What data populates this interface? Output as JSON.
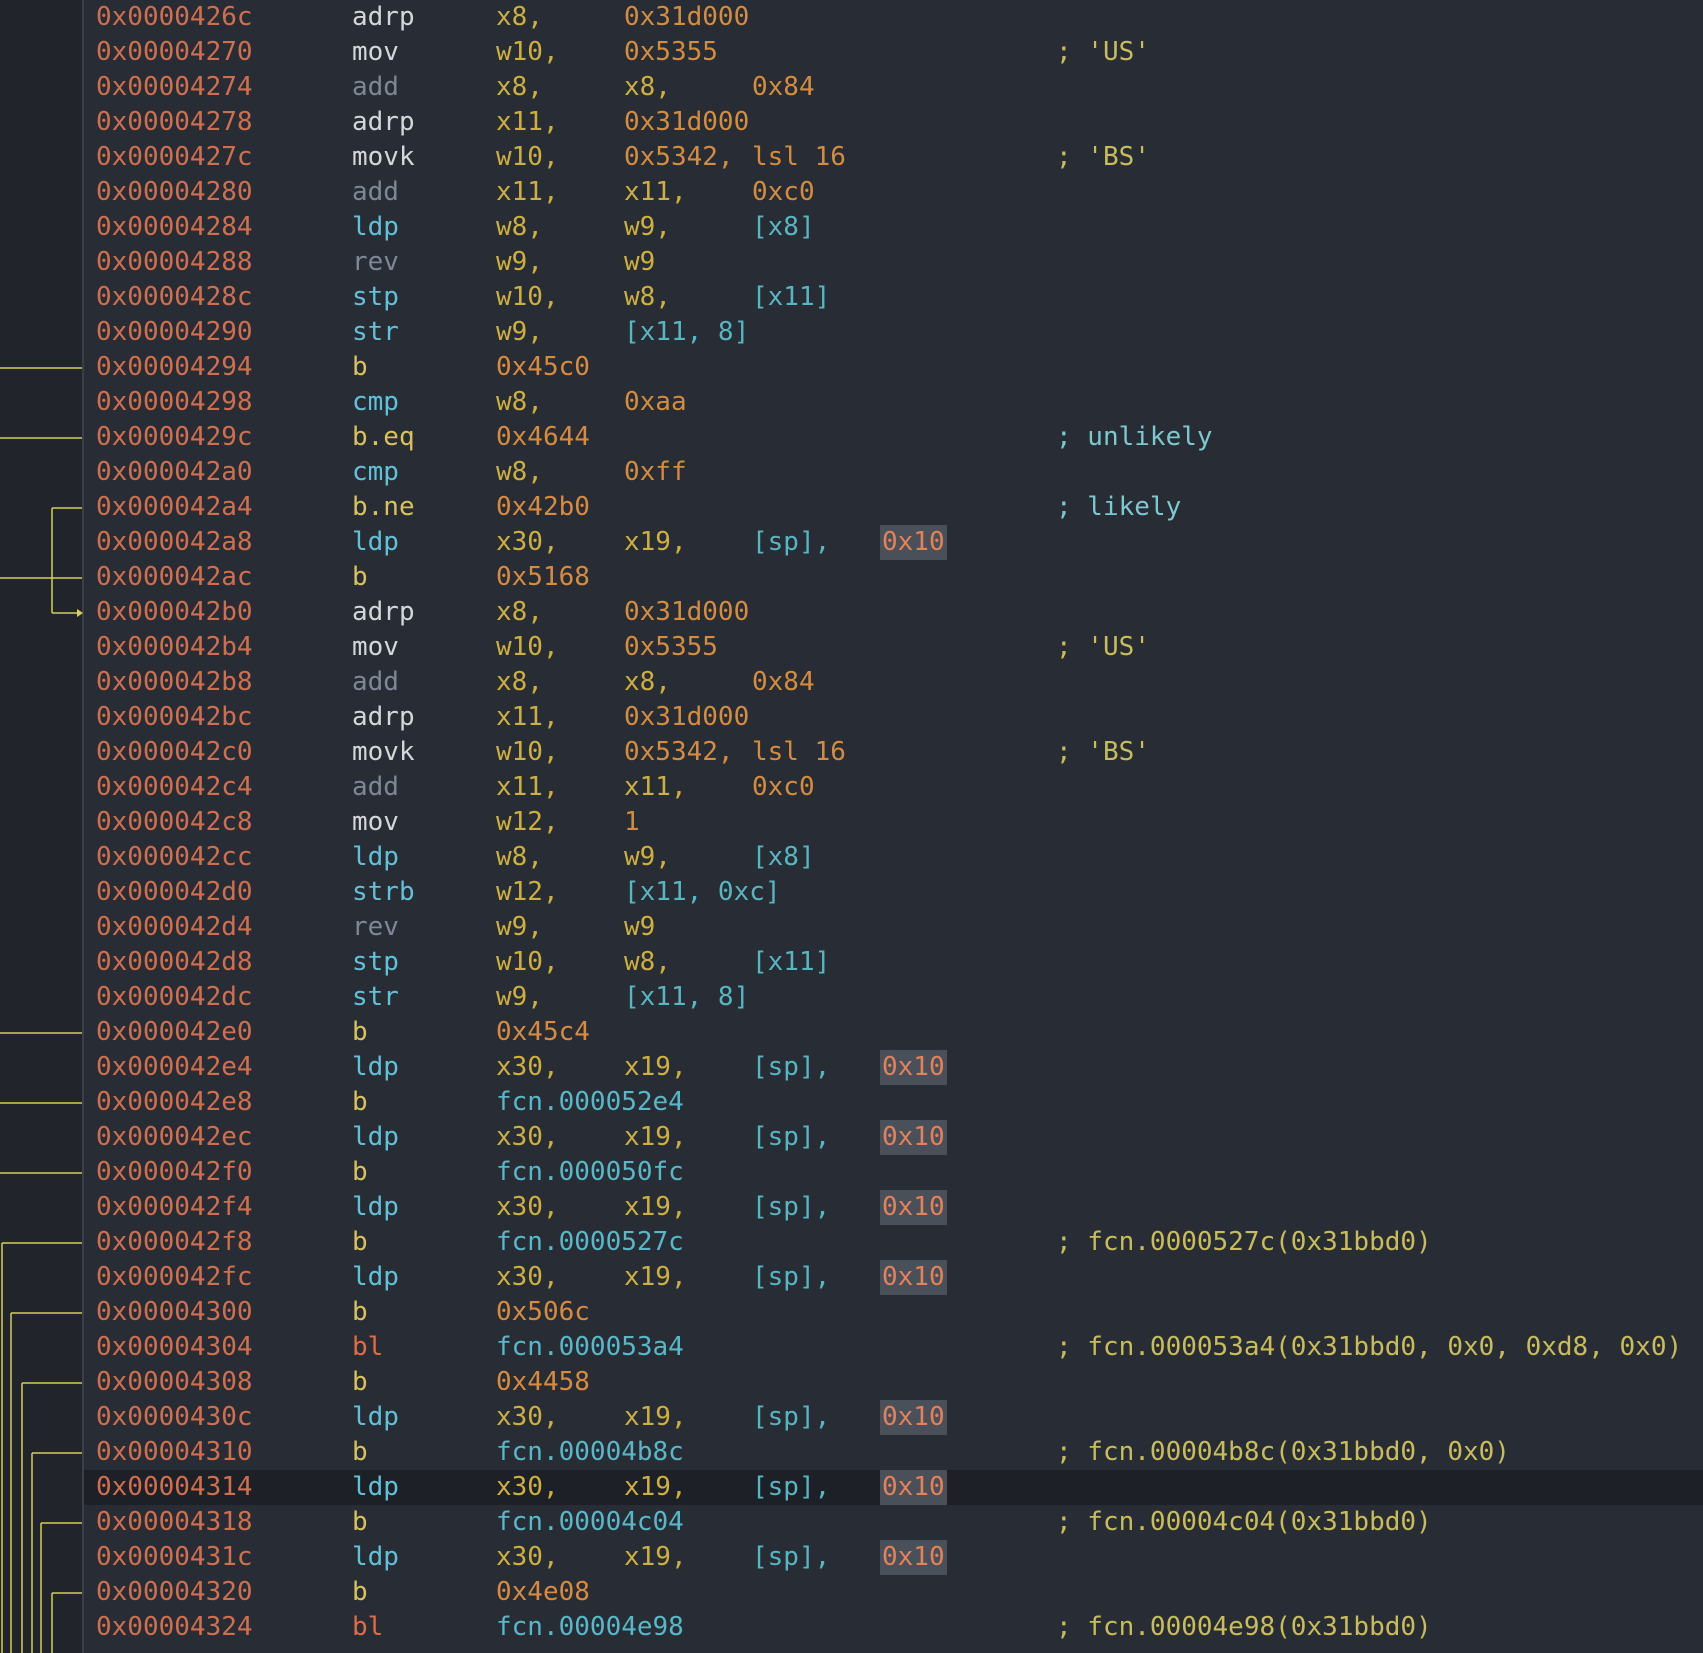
{
  "colors": {
    "background": "#282c34",
    "gutter": "#21252b",
    "address": "#d06f4f",
    "register": "#cdb03f",
    "immediate": "#d48c3e",
    "memory": "#56b6c2",
    "branch_mnemonic": "#d9c25e",
    "call_mnemonic": "#e06c45",
    "arrow": "#d6cf58",
    "highlight_bg": "#4a505a"
  },
  "rows": [
    {
      "addr": "0x0000426c",
      "mn": "adrp",
      "o": [
        [
          "x8,",
          "reg"
        ],
        [
          "0x31d000",
          "num"
        ]
      ]
    },
    {
      "addr": "0x00004270",
      "mn": "mov",
      "o": [
        [
          "w10,",
          "reg"
        ],
        [
          "0x5355",
          "num"
        ]
      ],
      "cm": "; 'US'",
      "cmk": "cmf"
    },
    {
      "addr": "0x00004274",
      "mn": "add",
      "o": [
        [
          "x8,",
          "reg"
        ],
        [
          "x8,",
          "reg"
        ],
        [
          "0x84",
          "num"
        ]
      ]
    },
    {
      "addr": "0x00004278",
      "mn": "adrp",
      "o": [
        [
          "x11,",
          "reg"
        ],
        [
          "0x31d000",
          "num"
        ]
      ]
    },
    {
      "addr": "0x0000427c",
      "mn": "movk",
      "o": [
        [
          "w10,",
          "reg"
        ],
        [
          "0x5342,",
          "num"
        ],
        [
          "lsl 16",
          "num"
        ]
      ],
      "cm": "; 'BS'",
      "cmk": "cmf"
    },
    {
      "addr": "0x00004280",
      "mn": "add",
      "o": [
        [
          "x11,",
          "reg"
        ],
        [
          "x11,",
          "reg"
        ],
        [
          "0xc0",
          "num"
        ]
      ]
    },
    {
      "addr": "0x00004284",
      "mn": "ldp",
      "o": [
        [
          "w8,",
          "reg"
        ],
        [
          "w9,",
          "reg"
        ],
        [
          "[x8]",
          "mem"
        ]
      ]
    },
    {
      "addr": "0x00004288",
      "mn": "rev",
      "o": [
        [
          "w9,",
          "reg"
        ],
        [
          "w9",
          "reg"
        ]
      ]
    },
    {
      "addr": "0x0000428c",
      "mn": "stp",
      "o": [
        [
          "w10,",
          "reg"
        ],
        [
          "w8,",
          "reg"
        ],
        [
          "[x11]",
          "mem"
        ]
      ]
    },
    {
      "addr": "0x00004290",
      "mn": "str",
      "o": [
        [
          "w9,",
          "reg"
        ],
        [
          "[x11, 8]",
          "mem"
        ]
      ]
    },
    {
      "addr": "0x00004294",
      "mn": "b",
      "o": [
        [
          "0x45c0",
          "dst"
        ]
      ]
    },
    {
      "addr": "0x00004298",
      "mn": "cmp",
      "o": [
        [
          "w8,",
          "reg"
        ],
        [
          "0xaa",
          "num"
        ]
      ]
    },
    {
      "addr": "0x0000429c",
      "mn": "b.eq",
      "o": [
        [
          "0x4644",
          "dst"
        ]
      ],
      "cm": "; unlikely",
      "cmk": "cmt"
    },
    {
      "addr": "0x000042a0",
      "mn": "cmp",
      "o": [
        [
          "w8,",
          "reg"
        ],
        [
          "0xff",
          "num"
        ]
      ]
    },
    {
      "addr": "0x000042a4",
      "mn": "b.ne",
      "o": [
        [
          "0x42b0",
          "dst"
        ]
      ],
      "cm": "; likely",
      "cmk": "cmt"
    },
    {
      "addr": "0x000042a8",
      "mn": "ldp",
      "o": [
        [
          "x30,",
          "reg"
        ],
        [
          "x19,",
          "reg"
        ],
        [
          "[sp],",
          "mem"
        ],
        [
          "0x10",
          "hl"
        ]
      ]
    },
    {
      "addr": "0x000042ac",
      "mn": "b",
      "o": [
        [
          "0x5168",
          "dst"
        ]
      ]
    },
    {
      "addr": "0x000042b0",
      "mn": "adrp",
      "o": [
        [
          "x8,",
          "reg"
        ],
        [
          "0x31d000",
          "num"
        ]
      ]
    },
    {
      "addr": "0x000042b4",
      "mn": "mov",
      "o": [
        [
          "w10,",
          "reg"
        ],
        [
          "0x5355",
          "num"
        ]
      ],
      "cm": "; 'US'",
      "cmk": "cmf"
    },
    {
      "addr": "0x000042b8",
      "mn": "add",
      "o": [
        [
          "x8,",
          "reg"
        ],
        [
          "x8,",
          "reg"
        ],
        [
          "0x84",
          "num"
        ]
      ]
    },
    {
      "addr": "0x000042bc",
      "mn": "adrp",
      "o": [
        [
          "x11,",
          "reg"
        ],
        [
          "0x31d000",
          "num"
        ]
      ]
    },
    {
      "addr": "0x000042c0",
      "mn": "movk",
      "o": [
        [
          "w10,",
          "reg"
        ],
        [
          "0x5342,",
          "num"
        ],
        [
          "lsl 16",
          "num"
        ]
      ],
      "cm": "; 'BS'",
      "cmk": "cmf"
    },
    {
      "addr": "0x000042c4",
      "mn": "add",
      "o": [
        [
          "x11,",
          "reg"
        ],
        [
          "x11,",
          "reg"
        ],
        [
          "0xc0",
          "num"
        ]
      ]
    },
    {
      "addr": "0x000042c8",
      "mn": "mov",
      "o": [
        [
          "w12,",
          "reg"
        ],
        [
          "1",
          "num"
        ]
      ]
    },
    {
      "addr": "0x000042cc",
      "mn": "ldp",
      "o": [
        [
          "w8,",
          "reg"
        ],
        [
          "w9,",
          "reg"
        ],
        [
          "[x8]",
          "mem"
        ]
      ]
    },
    {
      "addr": "0x000042d0",
      "mn": "strb",
      "o": [
        [
          "w12,",
          "reg"
        ],
        [
          "[x11, 0xc]",
          "mem"
        ]
      ]
    },
    {
      "addr": "0x000042d4",
      "mn": "rev",
      "o": [
        [
          "w9,",
          "reg"
        ],
        [
          "w9",
          "reg"
        ]
      ]
    },
    {
      "addr": "0x000042d8",
      "mn": "stp",
      "o": [
        [
          "w10,",
          "reg"
        ],
        [
          "w8,",
          "reg"
        ],
        [
          "[x11]",
          "mem"
        ]
      ]
    },
    {
      "addr": "0x000042dc",
      "mn": "str",
      "o": [
        [
          "w9,",
          "reg"
        ],
        [
          "[x11, 8]",
          "mem"
        ]
      ]
    },
    {
      "addr": "0x000042e0",
      "mn": "b",
      "o": [
        [
          "0x45c4",
          "dst"
        ]
      ]
    },
    {
      "addr": "0x000042e4",
      "mn": "ldp",
      "o": [
        [
          "x30,",
          "reg"
        ],
        [
          "x19,",
          "reg"
        ],
        [
          "[sp],",
          "mem"
        ],
        [
          "0x10",
          "hl"
        ]
      ]
    },
    {
      "addr": "0x000042e8",
      "mn": "b",
      "o": [
        [
          "fcn.000052e4",
          "fcn"
        ]
      ]
    },
    {
      "addr": "0x000042ec",
      "mn": "ldp",
      "o": [
        [
          "x30,",
          "reg"
        ],
        [
          "x19,",
          "reg"
        ],
        [
          "[sp],",
          "mem"
        ],
        [
          "0x10",
          "hl"
        ]
      ]
    },
    {
      "addr": "0x000042f0",
      "mn": "b",
      "o": [
        [
          "fcn.000050fc",
          "fcn"
        ]
      ]
    },
    {
      "addr": "0x000042f4",
      "mn": "ldp",
      "o": [
        [
          "x30,",
          "reg"
        ],
        [
          "x19,",
          "reg"
        ],
        [
          "[sp],",
          "mem"
        ],
        [
          "0x10",
          "hl"
        ]
      ]
    },
    {
      "addr": "0x000042f8",
      "mn": "b",
      "o": [
        [
          "fcn.0000527c",
          "fcn"
        ]
      ],
      "cm": "; fcn.0000527c(0x31bbd0)",
      "cmk": "cmf"
    },
    {
      "addr": "0x000042fc",
      "mn": "ldp",
      "o": [
        [
          "x30,",
          "reg"
        ],
        [
          "x19,",
          "reg"
        ],
        [
          "[sp],",
          "mem"
        ],
        [
          "0x10",
          "hl"
        ]
      ]
    },
    {
      "addr": "0x00004300",
      "mn": "b",
      "o": [
        [
          "0x506c",
          "dst"
        ]
      ]
    },
    {
      "addr": "0x00004304",
      "mn": "bl",
      "o": [
        [
          "fcn.000053a4",
          "fcn"
        ]
      ],
      "cm": "; fcn.000053a4(0x31bbd0, 0x0, 0xd8, 0x0)",
      "cmk": "cmf"
    },
    {
      "addr": "0x00004308",
      "mn": "b",
      "o": [
        [
          "0x4458",
          "dst"
        ]
      ]
    },
    {
      "addr": "0x0000430c",
      "mn": "ldp",
      "o": [
        [
          "x30,",
          "reg"
        ],
        [
          "x19,",
          "reg"
        ],
        [
          "[sp],",
          "mem"
        ],
        [
          "0x10",
          "hl"
        ]
      ]
    },
    {
      "addr": "0x00004310",
      "mn": "b",
      "o": [
        [
          "fcn.00004b8c",
          "fcn"
        ]
      ],
      "cm": "; fcn.00004b8c(0x31bbd0, 0x0)",
      "cmk": "cmf"
    },
    {
      "addr": "0x00004314",
      "mn": "ldp",
      "o": [
        [
          "x30,",
          "reg"
        ],
        [
          "x19,",
          "reg"
        ],
        [
          "[sp],",
          "mem"
        ],
        [
          "0x10",
          "hl"
        ]
      ],
      "current": true
    },
    {
      "addr": "0x00004318",
      "mn": "b",
      "o": [
        [
          "fcn.00004c04",
          "fcn"
        ]
      ],
      "cm": "; fcn.00004c04(0x31bbd0)",
      "cmk": "cmf"
    },
    {
      "addr": "0x0000431c",
      "mn": "ldp",
      "o": [
        [
          "x30,",
          "reg"
        ],
        [
          "x19,",
          "reg"
        ],
        [
          "[sp],",
          "mem"
        ],
        [
          "0x10",
          "hl"
        ]
      ]
    },
    {
      "addr": "0x00004320",
      "mn": "b",
      "o": [
        [
          "0x4e08",
          "dst"
        ]
      ]
    },
    {
      "addr": "0x00004324",
      "mn": "bl",
      "o": [
        [
          "fcn.00004e98",
          "fcn"
        ]
      ],
      "cm": "; fcn.00004e98(0x31bbd0)",
      "cmk": "cmf"
    }
  ]
}
